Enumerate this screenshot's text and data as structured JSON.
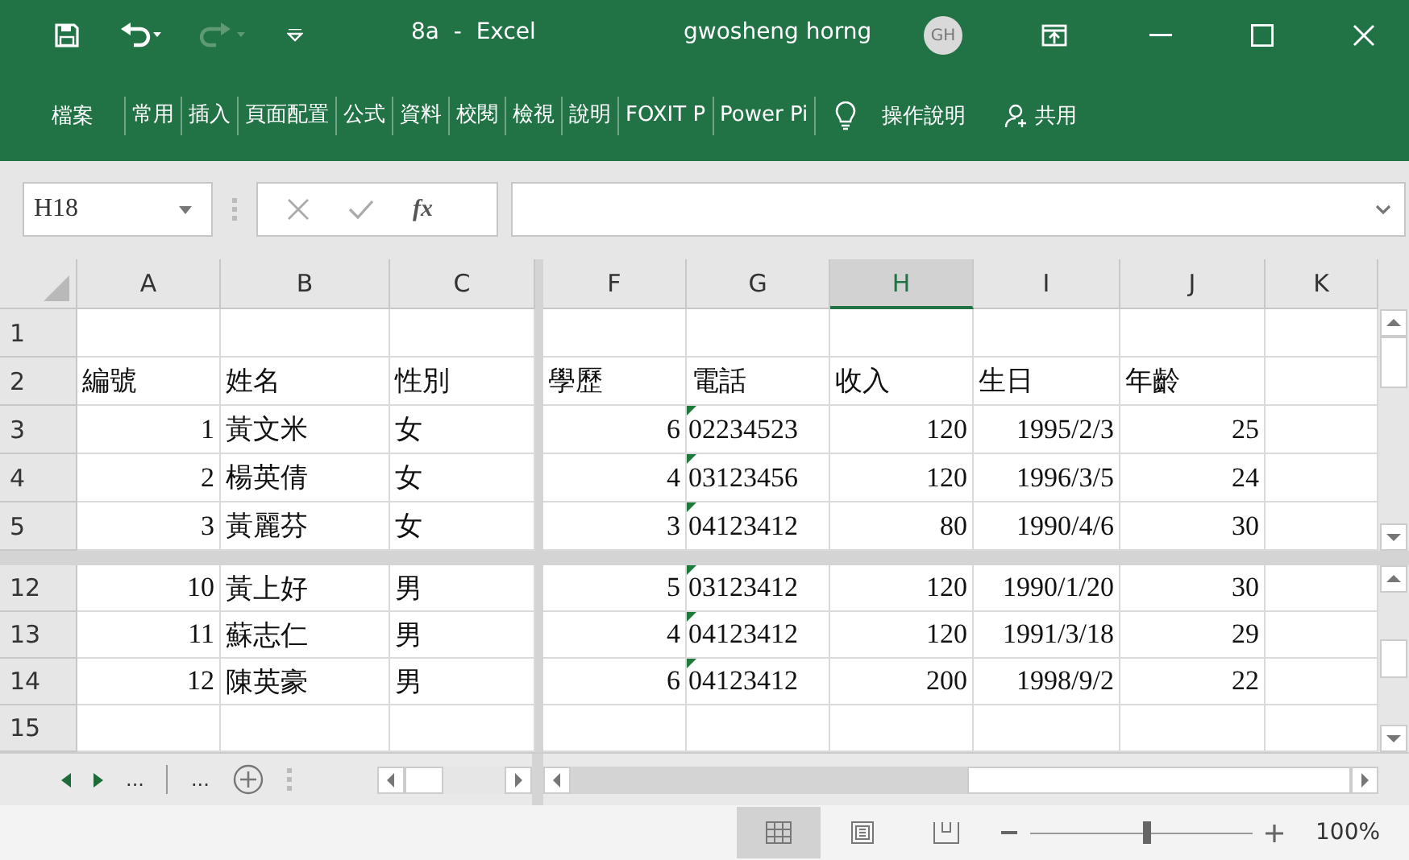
{
  "window": {
    "title": "8a  -  Excel",
    "user": "gwosheng horng",
    "avatar": "GH"
  },
  "ribbon": {
    "file_tab": "檔案",
    "tabs": [
      {
        "label": "常用",
        "selected": false
      },
      {
        "label": "插入",
        "selected": false
      },
      {
        "label": "頁面配置",
        "selected": false
      },
      {
        "label": "公式",
        "selected": false
      },
      {
        "label": "資料",
        "selected": false
      },
      {
        "label": "校閱",
        "selected": false
      },
      {
        "label": "檢視",
        "selected": false
      },
      {
        "label": "說明",
        "selected": false
      },
      {
        "label": "FOXIT P",
        "selected": false
      },
      {
        "label": "Power Pi",
        "selected": false
      }
    ],
    "tell_me": "操作說明",
    "share": "共用"
  },
  "formula_bar": {
    "name_box": "H18",
    "function_label": "fx"
  },
  "columns": [
    {
      "label": "A",
      "selected": false
    },
    {
      "label": "B",
      "selected": false
    },
    {
      "label": "C",
      "selected": false
    },
    {
      "label": "F",
      "selected": false
    },
    {
      "label": "G",
      "selected": false
    },
    {
      "label": "H",
      "selected": true
    },
    {
      "label": "I",
      "selected": false
    },
    {
      "label": "J",
      "selected": false
    },
    {
      "label": "K",
      "selected": false
    }
  ],
  "top_pane": [
    {
      "row": "1",
      "cells": [
        {},
        {},
        {},
        {},
        {},
        {},
        {},
        {},
        {}
      ]
    },
    {
      "row": "2",
      "cells": [
        {
          "text": "編號",
          "kind": "text"
        },
        {
          "text": "姓名",
          "kind": "text"
        },
        {
          "text": "性別",
          "kind": "text"
        },
        {
          "text": "學歷",
          "kind": "text"
        },
        {
          "text": "電話",
          "kind": "text"
        },
        {
          "text": "收入",
          "kind": "text"
        },
        {
          "text": "生日",
          "kind": "text"
        },
        {
          "text": "年齡",
          "kind": "text"
        },
        {}
      ]
    },
    {
      "row": "3",
      "cells": [
        {
          "text": "1",
          "kind": "number"
        },
        {
          "text": "黃文米",
          "kind": "text"
        },
        {
          "text": "女",
          "kind": "text"
        },
        {
          "text": "6",
          "kind": "number"
        },
        {
          "text": "02234523",
          "kind": "flagged"
        },
        {
          "text": "120",
          "kind": "number"
        },
        {
          "text": "1995/2/3",
          "kind": "number"
        },
        {
          "text": "25",
          "kind": "number"
        },
        {}
      ]
    },
    {
      "row": "4",
      "cells": [
        {
          "text": "2",
          "kind": "number"
        },
        {
          "text": "楊英倩",
          "kind": "text"
        },
        {
          "text": "女",
          "kind": "text"
        },
        {
          "text": "4",
          "kind": "number"
        },
        {
          "text": "03123456",
          "kind": "flagged"
        },
        {
          "text": "120",
          "kind": "number"
        },
        {
          "text": "1996/3/5",
          "kind": "number"
        },
        {
          "text": "24",
          "kind": "number"
        },
        {}
      ]
    },
    {
      "row": "5",
      "cells": [
        {
          "text": "3",
          "kind": "number"
        },
        {
          "text": "黃麗芬",
          "kind": "text"
        },
        {
          "text": "女",
          "kind": "text"
        },
        {
          "text": "3",
          "kind": "number"
        },
        {
          "text": "04123412",
          "kind": "flagged"
        },
        {
          "text": "80",
          "kind": "number"
        },
        {
          "text": "1990/4/6",
          "kind": "number"
        },
        {
          "text": "30",
          "kind": "number"
        },
        {}
      ]
    }
  ],
  "bottom_pane": [
    {
      "row": "12",
      "cells": [
        {
          "text": "10",
          "kind": "number"
        },
        {
          "text": "黃上好",
          "kind": "text"
        },
        {
          "text": "男",
          "kind": "text"
        },
        {
          "text": "5",
          "kind": "number"
        },
        {
          "text": "03123412",
          "kind": "flagged"
        },
        {
          "text": "120",
          "kind": "number"
        },
        {
          "text": "1990/1/20",
          "kind": "number"
        },
        {
          "text": "30",
          "kind": "number"
        },
        {}
      ]
    },
    {
      "row": "13",
      "cells": [
        {
          "text": "11",
          "kind": "number"
        },
        {
          "text": "蘇志仁",
          "kind": "text"
        },
        {
          "text": "男",
          "kind": "text"
        },
        {
          "text": "4",
          "kind": "number"
        },
        {
          "text": "04123412",
          "kind": "flagged"
        },
        {
          "text": "120",
          "kind": "number"
        },
        {
          "text": "1991/3/18",
          "kind": "number"
        },
        {
          "text": "29",
          "kind": "number"
        },
        {}
      ]
    },
    {
      "row": "14",
      "cells": [
        {
          "text": "12",
          "kind": "number"
        },
        {
          "text": "陳英豪",
          "kind": "text"
        },
        {
          "text": "男",
          "kind": "text"
        },
        {
          "text": "6",
          "kind": "number"
        },
        {
          "text": "04123412",
          "kind": "flagged"
        },
        {
          "text": "200",
          "kind": "number"
        },
        {
          "text": "1998/9/2",
          "kind": "number"
        },
        {
          "text": "22",
          "kind": "number"
        },
        {}
      ]
    },
    {
      "row": "15",
      "cells": [
        {},
        {},
        {},
        {},
        {},
        {},
        {},
        {},
        {}
      ]
    }
  ],
  "sheet_bar": {
    "overflow_left": "...",
    "overflow_right": "..."
  },
  "status_bar": {
    "views": [
      {
        "kind": "normal",
        "selected": true
      },
      {
        "kind": "page_layout",
        "selected": false
      },
      {
        "kind": "page_break",
        "selected": false
      }
    ],
    "zoom": {
      "level": 0.52,
      "reading": "100%"
    }
  }
}
